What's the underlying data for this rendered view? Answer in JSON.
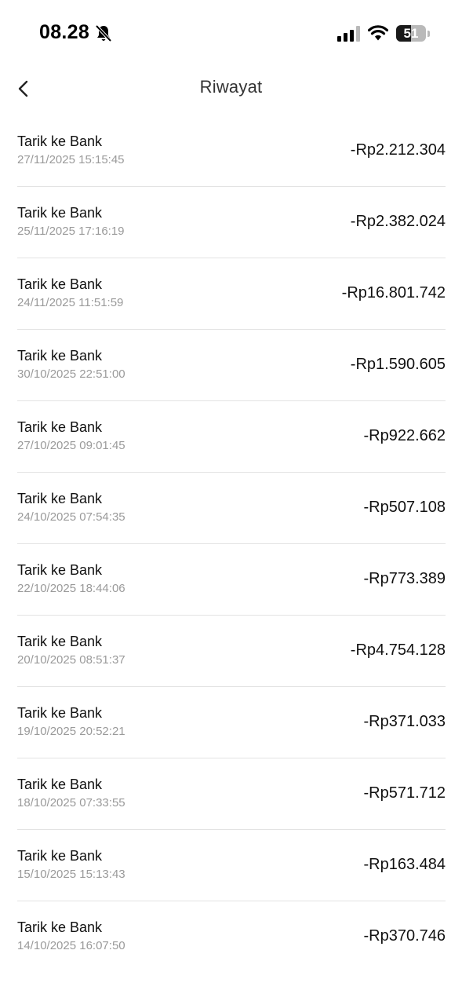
{
  "status_bar": {
    "time": "08.28",
    "battery_level": "51",
    "battery_fraction": 0.51,
    "icons": [
      "bell-slash-icon",
      "cellular-signal-icon",
      "wifi-icon",
      "battery-icon"
    ]
  },
  "header": {
    "title": "Riwayat",
    "back_icon": "chevron-left-icon"
  },
  "transactions": [
    {
      "title": "Tarik ke Bank",
      "datetime": "27/11/2025 15:15:45",
      "amount": "-Rp2.212.304"
    },
    {
      "title": "Tarik ke Bank",
      "datetime": "25/11/2025 17:16:19",
      "amount": "-Rp2.382.024"
    },
    {
      "title": "Tarik ke Bank",
      "datetime": "24/11/2025 11:51:59",
      "amount": "-Rp16.801.742"
    },
    {
      "title": "Tarik ke Bank",
      "datetime": "30/10/2025 22:51:00",
      "amount": "-Rp1.590.605"
    },
    {
      "title": "Tarik ke Bank",
      "datetime": "27/10/2025 09:01:45",
      "amount": "-Rp922.662"
    },
    {
      "title": "Tarik ke Bank",
      "datetime": "24/10/2025 07:54:35",
      "amount": "-Rp507.108"
    },
    {
      "title": "Tarik ke Bank",
      "datetime": "22/10/2025 18:44:06",
      "amount": "-Rp773.389"
    },
    {
      "title": "Tarik ke Bank",
      "datetime": "20/10/2025 08:51:37",
      "amount": "-Rp4.754.128"
    },
    {
      "title": "Tarik ke Bank",
      "datetime": "19/10/2025 20:52:21",
      "amount": "-Rp371.033"
    },
    {
      "title": "Tarik ke Bank",
      "datetime": "18/10/2025 07:33:55",
      "amount": "-Rp571.712"
    },
    {
      "title": "Tarik ke Bank",
      "datetime": "15/10/2025 15:13:43",
      "amount": "-Rp163.484"
    },
    {
      "title": "Tarik ke Bank",
      "datetime": "14/10/2025 16:07:50",
      "amount": "-Rp370.746"
    }
  ],
  "colors": {
    "background": "#ffffff",
    "primary_text": "#111111",
    "secondary_text": "#9a9a9a",
    "divider": "#e3e3e3"
  }
}
